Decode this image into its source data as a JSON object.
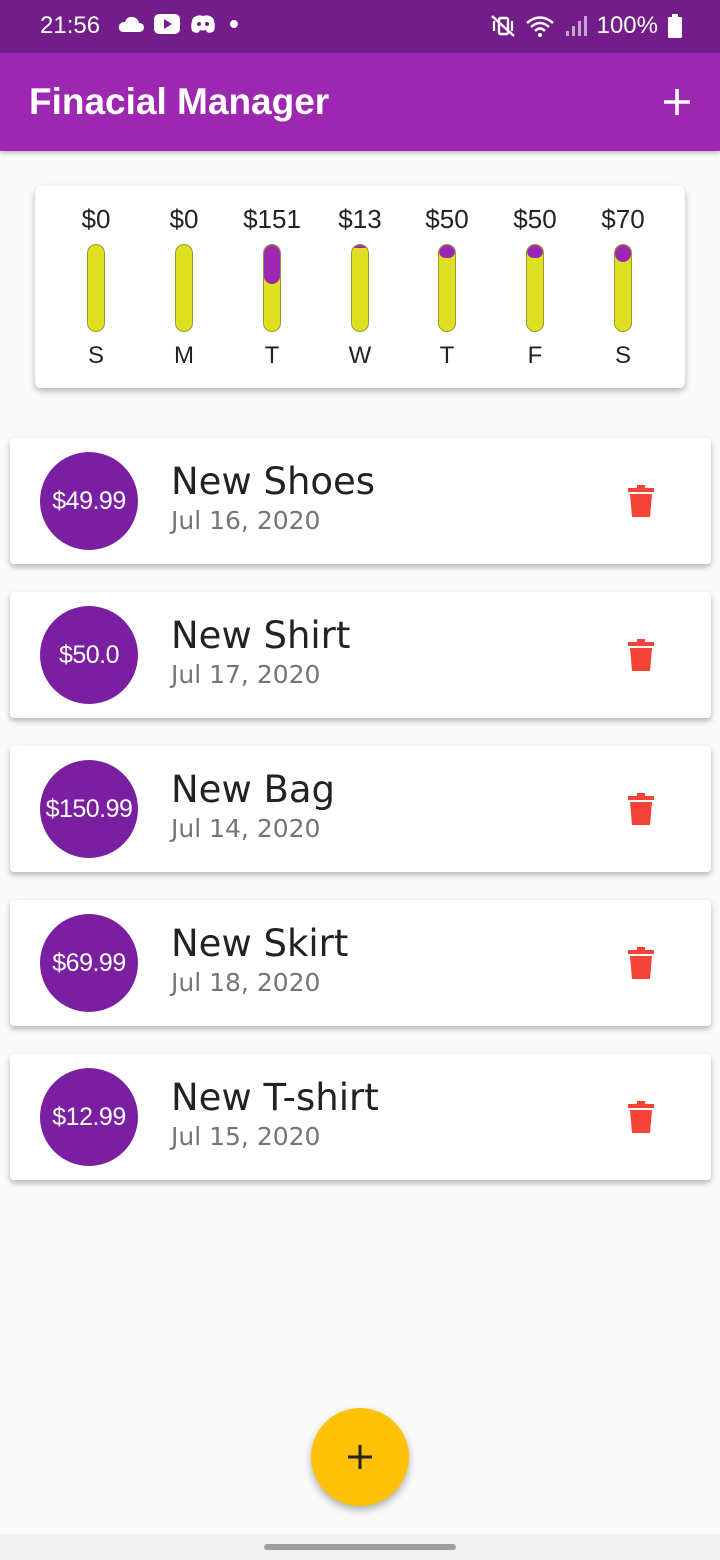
{
  "status_bar": {
    "time": "21:56",
    "battery_percent": "100%",
    "left_icons": [
      "cloud-icon",
      "youtube-icon",
      "discord-icon",
      "dot-icon"
    ],
    "right_icons": [
      "mute-vibrate-icon",
      "wifi-icon",
      "signal-icon",
      "battery-icon"
    ]
  },
  "app_bar": {
    "title": "Finacial Manager",
    "add_icon": "plus-icon"
  },
  "chart": {
    "fill_color": "#9c27b0",
    "track_color": "#e0e022",
    "days": [
      {
        "letter": "S",
        "amount": "$0",
        "fraction": 0
      },
      {
        "letter": "M",
        "amount": "$0",
        "fraction": 0
      },
      {
        "letter": "T",
        "amount": "$151",
        "fraction": 0.45
      },
      {
        "letter": "W",
        "amount": "$13",
        "fraction": 0.04
      },
      {
        "letter": "T",
        "amount": "$50",
        "fraction": 0.15
      },
      {
        "letter": "F",
        "amount": "$50",
        "fraction": 0.15
      },
      {
        "letter": "S",
        "amount": "$70",
        "fraction": 0.2
      }
    ]
  },
  "transactions": [
    {
      "amount": "$49.99",
      "title": "New Shoes",
      "date": "Jul 16, 2020"
    },
    {
      "amount": "$50.0",
      "title": "New Shirt",
      "date": "Jul 17, 2020"
    },
    {
      "amount": "$150.99",
      "title": "New Bag",
      "date": "Jul 14, 2020"
    },
    {
      "amount": "$69.99",
      "title": "New Skirt",
      "date": "Jul 18, 2020"
    },
    {
      "amount": "$12.99",
      "title": "New T-shirt",
      "date": "Jul 15, 2020"
    }
  ],
  "colors": {
    "app_bar": "#9c27b0",
    "status_bar": "#731d8a",
    "avatar": "#7b1fa2",
    "delete": "#f44336",
    "fab": "#ffc107"
  },
  "fab": {
    "icon": "plus-icon"
  }
}
